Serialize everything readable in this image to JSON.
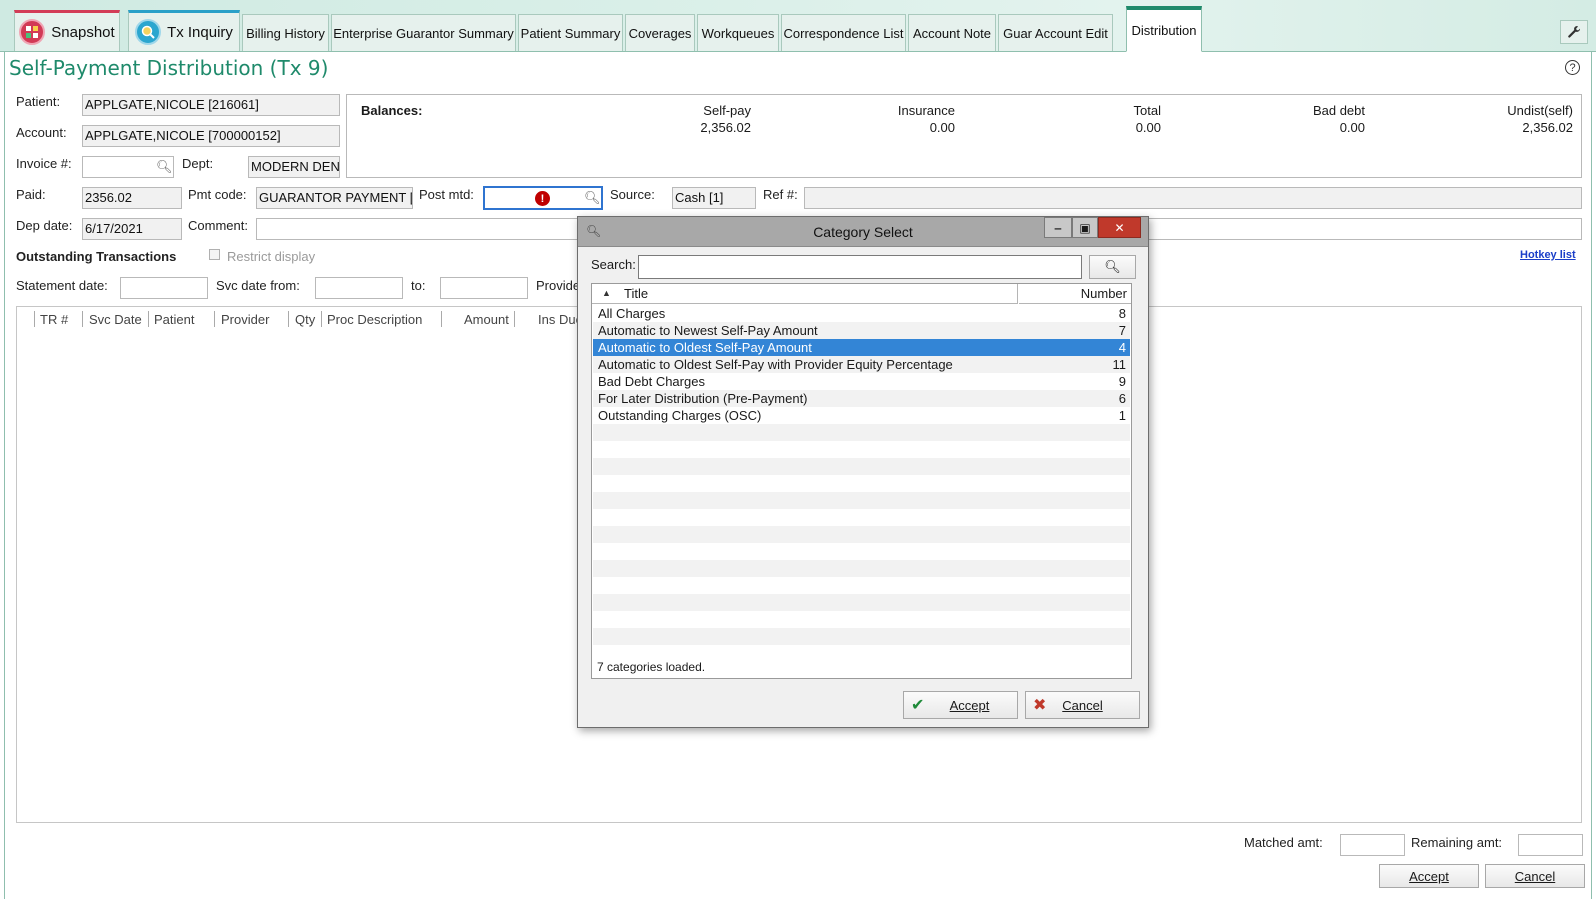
{
  "tabs": [
    {
      "label": "Snapshot"
    },
    {
      "label": "Tx Inquiry"
    },
    {
      "label": "Billing History"
    },
    {
      "label": "Enterprise Guarantor Summary"
    },
    {
      "label": "Patient Summary"
    },
    {
      "label": "Coverages"
    },
    {
      "label": "Workqueues"
    },
    {
      "label": "Correspondence List"
    },
    {
      "label": "Account Note"
    },
    {
      "label": "Guar Account Edit"
    },
    {
      "label": "Distribution"
    }
  ],
  "page": {
    "title": "Self-Payment Distribution (Tx 9)"
  },
  "form": {
    "patient_label": "Patient:",
    "patient_value": "APPLGATE,NICOLE [216061]",
    "account_label": "Account:",
    "account_value": "APPLGATE,NICOLE [700000152]",
    "invoice_label": "Invoice #:",
    "invoice_value": "",
    "dept_label": "Dept:",
    "dept_value": "MODERN DEN",
    "paid_label": "Paid:",
    "paid_value": "2356.02",
    "pmt_code_label": "Pmt code:",
    "pmt_code_value": "GUARANTOR PAYMENT [",
    "post_mtd_label": "Post mtd:",
    "post_mtd_value": "",
    "source_label": "Source:",
    "source_value": "Cash [1]",
    "ref_label": "Ref #:",
    "ref_value": "",
    "dep_date_label": "Dep date:",
    "dep_date_value": "6/17/2021",
    "comment_label": "Comment:",
    "comment_value": ""
  },
  "balances": {
    "heading": "Balances:",
    "columns": [
      {
        "label": "Self-pay",
        "value": "2,356.02"
      },
      {
        "label": "Insurance",
        "value": "0.00"
      },
      {
        "label": "Total",
        "value": "0.00"
      },
      {
        "label": "Bad debt",
        "value": "0.00"
      },
      {
        "label": "Undist(self)",
        "value": "2,356.02"
      }
    ]
  },
  "outstanding": {
    "heading": "Outstanding Transactions",
    "restrict_label": "Restrict display",
    "hotkey_link": "Hotkey list",
    "statement_date_label": "Statement date:",
    "svc_date_from_label": "Svc date from:",
    "to_label": "to:",
    "provider_label": "Provide",
    "columns": [
      "TR #",
      "Svc Date",
      "Patient",
      "Provider",
      "Qty",
      "Proc Description",
      "Amount",
      "Ins Due"
    ]
  },
  "footer": {
    "matched_label": "Matched amt:",
    "remaining_label": "Remaining amt:",
    "accept_label": "Accept",
    "cancel_label": "Cancel"
  },
  "dialog": {
    "title": "Category Select",
    "search_label": "Search:",
    "search_value": "",
    "col_title": "Title",
    "col_number": "Number",
    "rows": [
      {
        "title": "All Charges",
        "number": "8",
        "selected": false
      },
      {
        "title": "Automatic to Newest Self-Pay Amount",
        "number": "7",
        "selected": false
      },
      {
        "title": "Automatic to Oldest Self-Pay Amount",
        "number": "4",
        "selected": true
      },
      {
        "title": "Automatic to Oldest Self-Pay with Provider Equity Percentage",
        "number": "11",
        "selected": false
      },
      {
        "title": "Bad Debt Charges",
        "number": "9",
        "selected": false
      },
      {
        "title": "For Later Distribution (Pre-Payment)",
        "number": "6",
        "selected": false
      },
      {
        "title": "Outstanding Charges (OSC)",
        "number": "1",
        "selected": false
      }
    ],
    "status": "7 categories loaded.",
    "accept_label": "Accept",
    "cancel_label": "Cancel"
  },
  "colors": {
    "accent": "#1f8a6b",
    "selection": "#3385d6",
    "error": "#c00000"
  }
}
